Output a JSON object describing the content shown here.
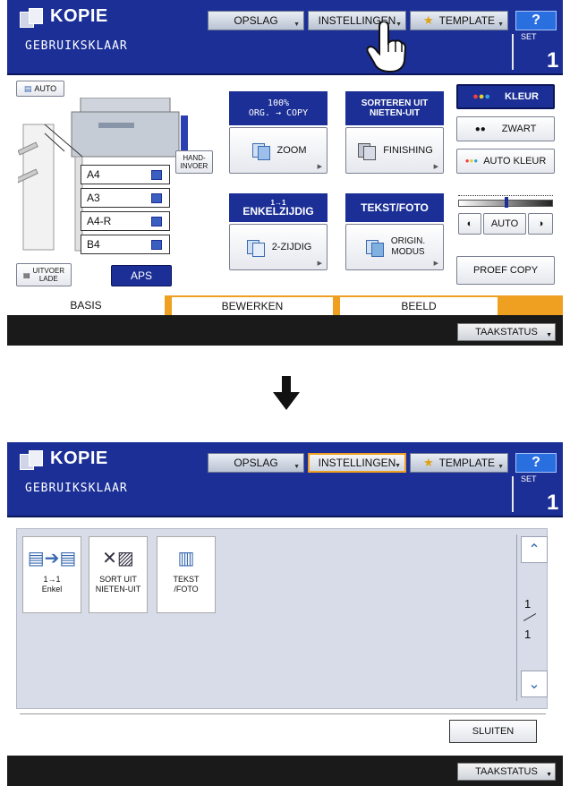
{
  "top_screen": {
    "header": {
      "title": "KOPIE",
      "status": "GEBRUIKSKLAAR",
      "set_label": "SET",
      "set_value": "1",
      "buttons": {
        "opslag": "OPSLAG",
        "instellingen": "INSTELLINGEN",
        "template": "TEMPLATE",
        "help": "?"
      }
    },
    "auto_label": "AUTO",
    "paper_sizes": [
      "A4",
      "A3",
      "A4-R",
      "B4"
    ],
    "hand_invoer": "HAND-\nINVOER",
    "uitvoer_lade": "UITVOER\nLADE",
    "aps": "APS",
    "zoom_header_1": "100%",
    "zoom_header_2": "ORG.  → COPY",
    "zoom_label": "ZOOM",
    "finishing_header": "SORTEREN UIT\nNIETEN-UIT",
    "finishing_label": "FINISHING",
    "duplex_header": "ENKELZIJDIG",
    "duplex_header_small": "1→1",
    "duplex_label": "2-ZIJDIG",
    "original_header": "TEKST/FOTO",
    "original_label": "ORIGIN.\nMODUS",
    "color_buttons": [
      "KLEUR",
      "ZWART",
      "AUTO KLEUR"
    ],
    "density_auto": "AUTO",
    "proef_copy": "PROEF COPY",
    "tabs": [
      "BASIS",
      "BEWERKEN",
      "BEELD"
    ],
    "taakstatus": "TAAKSTATUS"
  },
  "bottom_screen": {
    "header": {
      "title": "KOPIE",
      "status": "GEBRUIKSKLAAR",
      "set_label": "SET",
      "set_value": "1",
      "buttons": {
        "opslag": "OPSLAG",
        "instellingen": "INSTELLINGEN",
        "template": "TEMPLATE",
        "help": "?"
      }
    },
    "template_items": [
      {
        "line1": "1→1",
        "line2": "Enkel",
        "icon": "duplex-copy-icon"
      },
      {
        "line1": "SORT UIT",
        "line2": "NIETEN-UIT",
        "icon": "sort-staple-off-icon"
      },
      {
        "line1": "TEKST",
        "line2": "/FOTO",
        "icon": "text-photo-icon"
      }
    ],
    "page_current": "1",
    "page_total": "1",
    "sluiten": "SLUITEN",
    "taakstatus": "TAAKSTATUS"
  },
  "colors": {
    "header_blue": "#1b2f96",
    "active_border": "#f0a020",
    "help_blue": "#2a6fe0"
  }
}
